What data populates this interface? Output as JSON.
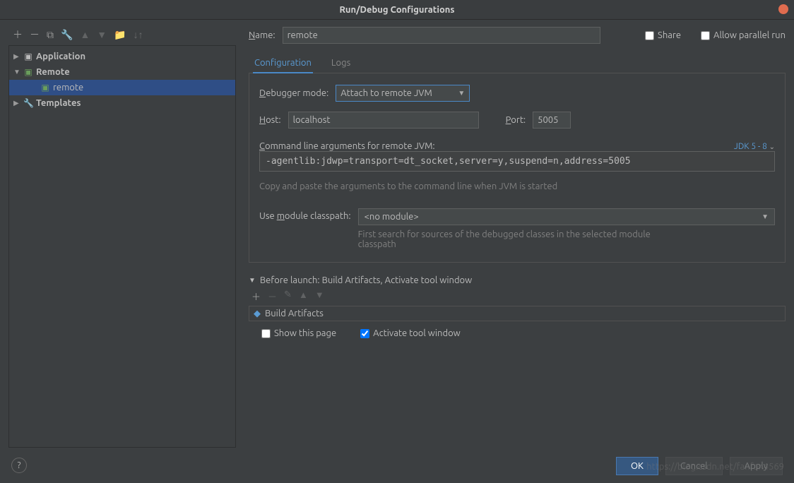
{
  "title": "Run/Debug Configurations",
  "tree": {
    "application": "Application",
    "remote": "Remote",
    "remote_item": "remote",
    "templates": "Templates"
  },
  "name_label": "Name:",
  "name_value": "remote",
  "share_label": "Share",
  "allow_parallel_label": "Allow parallel run",
  "tabs": {
    "configuration": "Configuration",
    "logs": "Logs"
  },
  "debugger_mode_label": "Debugger mode:",
  "debugger_mode_value": "Attach to remote JVM",
  "host_label": "Host:",
  "host_value": "localhost",
  "port_label": "Port:",
  "port_value": "5005",
  "cmd_label": "Command line arguments for remote JVM:",
  "jdk_label": "JDK 5 - 8",
  "cmd_value": "-agentlib:jdwp=transport=dt_socket,server=y,suspend=n,address=5005",
  "cmd_hint": "Copy and paste the arguments to the command line when JVM is started",
  "module_label": "Use module classpath:",
  "module_value": "<no module>",
  "module_hint": "First search for sources of the debugged classes in the selected module classpath",
  "before_launch_header": "Before launch: Build Artifacts, Activate tool window",
  "before_launch_item": "Build Artifacts",
  "show_this_page": "Show this page",
  "activate_tool": "Activate tool window",
  "buttons": {
    "ok": "OK",
    "cancel": "Cancel",
    "apply": "Apply"
  },
  "watermark": "https://blog.csdn.net/fanfan4569"
}
